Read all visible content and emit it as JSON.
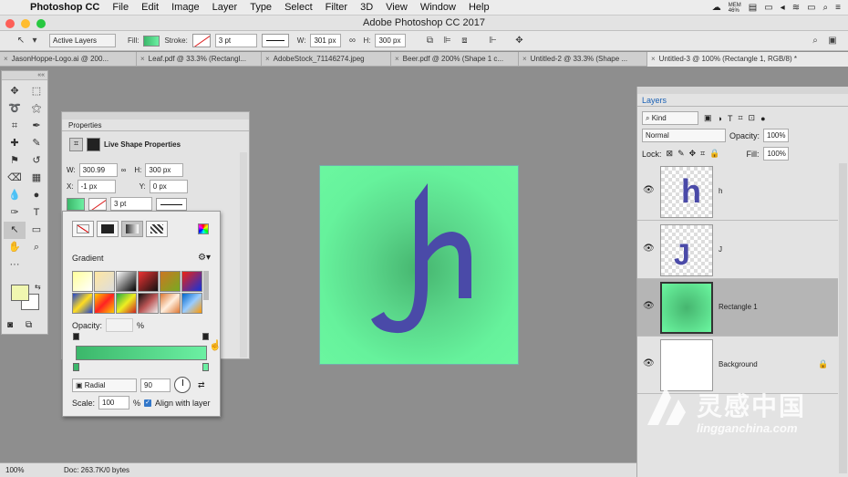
{
  "menubar": {
    "app_name": "Photoshop CC",
    "items": [
      "File",
      "Edit",
      "Image",
      "Layer",
      "Type",
      "Select",
      "Filter",
      "3D",
      "View",
      "Window",
      "Help"
    ],
    "mem_label": "MEM\n46%"
  },
  "window": {
    "title": "Adobe Photoshop CC 2017"
  },
  "options": {
    "pick": "Active Layers",
    "fill_label": "Fill:",
    "stroke_label": "Stroke:",
    "stroke_width": "3 pt",
    "w_label": "W:",
    "w_value": "301 px",
    "h_label": "H:",
    "h_value": "300 px"
  },
  "tabs": [
    "JasonHoppe-Logo.ai @ 200...",
    "Leaf.pdf @ 33.3% (Rectangl...",
    "AdobeStock_71146274.jpeg",
    "Beer.pdf @ 200% (Shape 1 c...",
    "Untitled-2 @ 33.3% (Shape ...",
    "Untitled-3 @ 100% (Rectangle 1, RGB/8) *"
  ],
  "properties": {
    "tab": "Properties",
    "section": "Live Shape Properties",
    "w_label": "W:",
    "w_value": "300.99 px",
    "h_label": "H:",
    "h_value": "300 px",
    "x_label": "X:",
    "x_value": "-1 px",
    "y_label": "Y:",
    "y_value": "0 px",
    "stroke_width": "3 pt"
  },
  "gradient_popup": {
    "title": "Gradient",
    "opacity_label": "Opacity:",
    "opacity_unit": "%",
    "style": "Radial",
    "angle": "90",
    "scale_label": "Scale:",
    "scale_value": "100",
    "scale_unit": "%",
    "align_label": "Align with layer"
  },
  "layers": {
    "tab": "Layers",
    "kind": "Kind",
    "blend_mode": "Normal",
    "opacity_label": "Opacity:",
    "opacity_value": "100%",
    "lock_label": "Lock:",
    "fill_label": "Fill:",
    "fill_value": "100%",
    "items": [
      {
        "name": "h",
        "thumb_letter": "h"
      },
      {
        "name": "J",
        "thumb_letter": "J"
      },
      {
        "name": "Rectangle 1"
      },
      {
        "name": "Background"
      }
    ]
  },
  "status": {
    "zoom": "100%",
    "doc": "Doc: 263.7K/0 bytes"
  },
  "watermark": {
    "chinese": "灵感中国",
    "url": "lingganchina.com"
  },
  "colors": {
    "artboard": "#6bf7a0",
    "logo": "#4a4aa8",
    "gradient_start": "#3bb76a",
    "gradient_end": "#6cf0a3",
    "foreground": "#f0f7b0"
  }
}
